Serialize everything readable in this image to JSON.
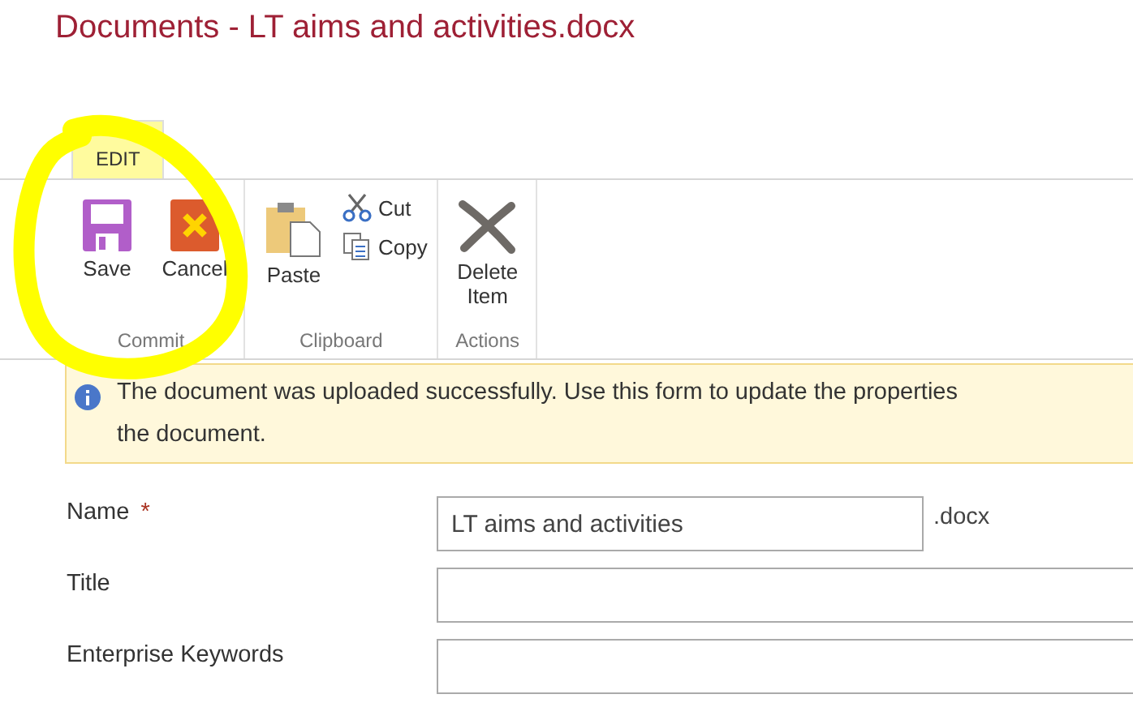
{
  "page_title": "Documents - LT aims and activities.docx",
  "tabs": [
    {
      "label": "EDIT",
      "selected": true
    }
  ],
  "ribbon_groups": [
    {
      "label": "Commit",
      "items": [
        {
          "label": "Save",
          "kind": "large"
        },
        {
          "label": "Cancel",
          "kind": "large"
        }
      ]
    },
    {
      "label": "Clipboard",
      "items": [
        {
          "label": "Paste",
          "kind": "large"
        },
        {
          "label": "Cut",
          "kind": "small"
        },
        {
          "label": "Copy",
          "kind": "small"
        }
      ]
    },
    {
      "label": "Actions",
      "items": [
        {
          "label": "Delete Item",
          "kind": "large"
        }
      ]
    }
  ],
  "message": {
    "lines": [
      "The document was uploaded successfully. Use this form to update the properties",
      "the document."
    ]
  },
  "fields": [
    {
      "label": "Name",
      "required_mark": "*",
      "value": "LT aims and activities",
      "suffix": ".docx"
    },
    {
      "label": "Title"
    },
    {
      "label": "Enterprise Keywords"
    }
  ]
}
